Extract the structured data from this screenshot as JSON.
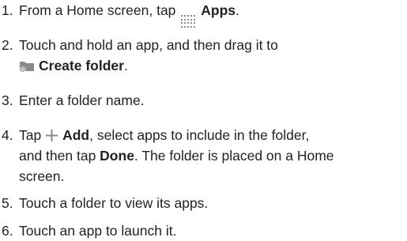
{
  "steps": [
    {
      "number": "1.",
      "text_before": "From a Home screen, tap ",
      "icon": "apps-grid-icon",
      "bold": "Apps",
      "text_after": "."
    },
    {
      "number": "2.",
      "line1": "Touch and hold an app, and then drag it to",
      "icon": "create-folder-icon",
      "bold": "Create folder",
      "text_after": "."
    },
    {
      "number": "3.",
      "text": "Enter a folder name."
    },
    {
      "number": "4.",
      "text_before": "Tap ",
      "icon": "plus-icon",
      "bold": "Add",
      "text_mid": ", select apps to include in the folder,",
      "line2_before": "and then tap ",
      "bold2": "Done",
      "line2_after": ". The folder is placed on a Home",
      "line3": "screen."
    },
    {
      "number": "5.",
      "text": "Touch a folder to view its apps."
    },
    {
      "number": "6.",
      "text": "Touch an app to launch it."
    }
  ],
  "colors": {
    "text": "#222222",
    "icon_gray": "#8a8a8a"
  }
}
